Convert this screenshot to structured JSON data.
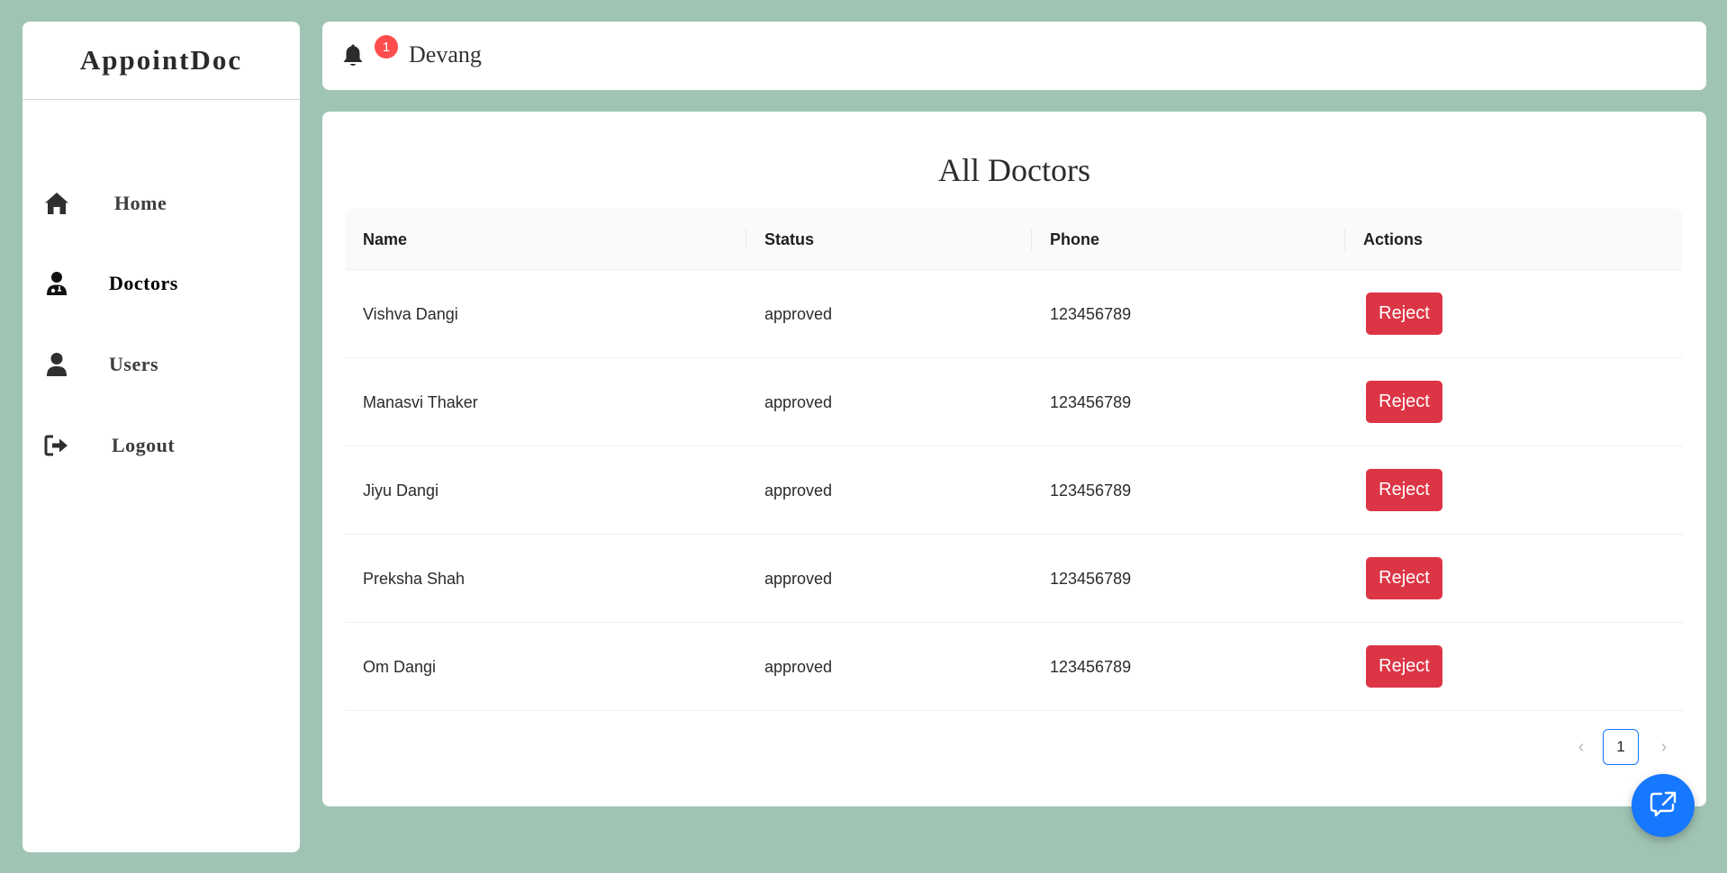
{
  "app": {
    "logo": "AppointDoc"
  },
  "sidebar": {
    "items": [
      {
        "label": "Home",
        "icon": "home-icon"
      },
      {
        "label": "Doctors",
        "icon": "doctor-icon"
      },
      {
        "label": "Users",
        "icon": "user-icon"
      },
      {
        "label": "Logout",
        "icon": "logout-icon"
      }
    ],
    "active": "Doctors"
  },
  "header": {
    "notification_count": "1",
    "username": "Devang"
  },
  "main": {
    "title": "All Doctors",
    "columns": [
      "Name",
      "Status",
      "Phone",
      "Actions"
    ],
    "rows": [
      {
        "name": "Vishva Dangi",
        "status": "approved",
        "phone": "123456789",
        "action": "Reject"
      },
      {
        "name": "Manasvi Thaker",
        "status": "approved",
        "phone": "123456789",
        "action": "Reject"
      },
      {
        "name": "Jiyu Dangi",
        "status": "approved",
        "phone": "123456789",
        "action": "Reject"
      },
      {
        "name": "Preksha Shah",
        "status": "approved",
        "phone": "123456789",
        "action": "Reject"
      },
      {
        "name": "Om Dangi",
        "status": "approved",
        "phone": "123456789",
        "action": "Reject"
      }
    ],
    "pagination": {
      "current_page": "1"
    }
  },
  "colors": {
    "background": "#a0c4b4",
    "reject": "#dc3545",
    "accent": "#1677ff",
    "badge": "#ff4d4f"
  }
}
